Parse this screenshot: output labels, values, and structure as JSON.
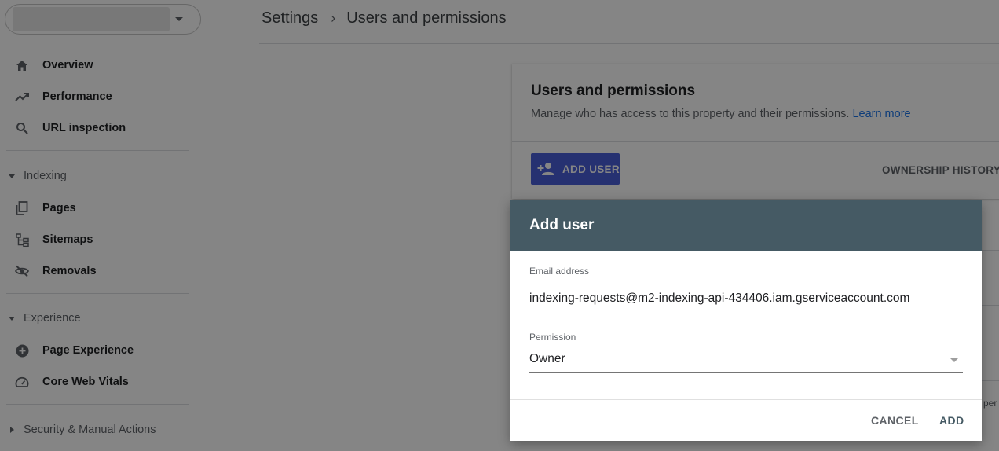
{
  "sidebar": {
    "property_value": "",
    "items": [
      {
        "label": "Overview",
        "icon": "home-icon"
      },
      {
        "label": "Performance",
        "icon": "trending-up-icon"
      },
      {
        "label": "URL inspection",
        "icon": "search-icon"
      }
    ],
    "sections": [
      {
        "label": "Indexing",
        "expanded": true,
        "items": [
          {
            "label": "Pages",
            "icon": "pages-icon"
          },
          {
            "label": "Sitemaps",
            "icon": "sitemap-icon"
          },
          {
            "label": "Removals",
            "icon": "visibility-off-icon"
          }
        ]
      },
      {
        "label": "Experience",
        "expanded": true,
        "items": [
          {
            "label": "Page Experience",
            "icon": "plus-circle-icon"
          },
          {
            "label": "Core Web Vitals",
            "icon": "speedometer-icon"
          }
        ]
      },
      {
        "label": "Security & Manual Actions",
        "expanded": false,
        "items": []
      }
    ]
  },
  "header": {
    "breadcrumb": [
      "Settings",
      "Users and permissions"
    ],
    "separator": "›"
  },
  "card": {
    "title": "Users and permissions",
    "subtitle": "Manage who has access to this property and their permissions.",
    "learn_more": "Learn more",
    "add_user": "ADD USER",
    "ownership_history": "OWNERSHIP HISTORY"
  },
  "background_stub_text": "per p",
  "dialog": {
    "title": "Add user",
    "email_label": "Email address",
    "email_value": "indexing-requests@m2-indexing-api-434406.iam.gserviceaccount.com",
    "permission_label": "Permission",
    "permission_value": "Owner",
    "cancel": "CANCEL",
    "add": "ADD"
  },
  "colors": {
    "dialog_header": "#455a64",
    "primary_button": "#4a5fd9",
    "link": "#1a73e8"
  }
}
